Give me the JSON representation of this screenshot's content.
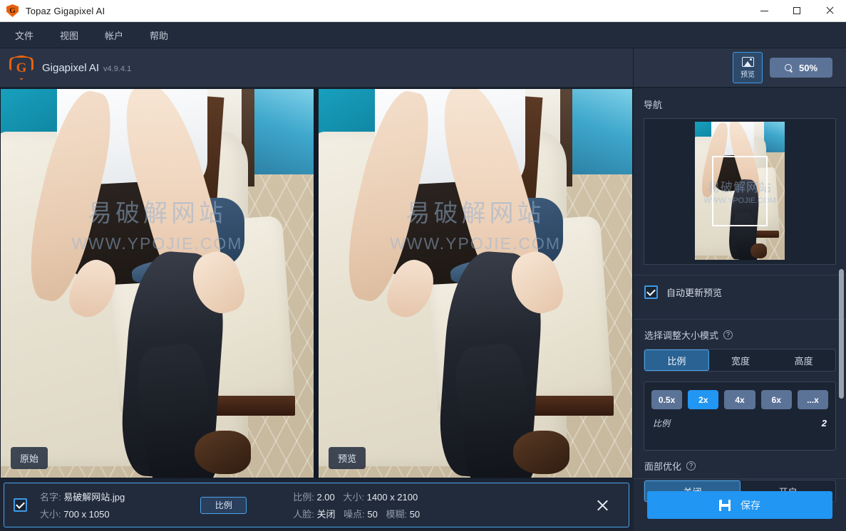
{
  "window": {
    "title": "Topaz Gigapixel AI",
    "logo_icon": "shield-g-icon",
    "minimize_icon": "minimize-icon",
    "maximize_icon": "maximize-icon",
    "close_icon": "close-icon"
  },
  "menubar": {
    "items": [
      {
        "label": "文件"
      },
      {
        "label": "视图"
      },
      {
        "label": "帐户"
      },
      {
        "label": "帮助"
      }
    ]
  },
  "header": {
    "brand_mark": "G",
    "brand_name": "Gigapixel AI",
    "version": "v4.9.4.1",
    "preview_button": {
      "label": "预览",
      "icon": "image-icon"
    },
    "zoom_button": {
      "label": "50%",
      "icon": "magnifier-icon"
    }
  },
  "compare": {
    "left": {
      "badge": "原始"
    },
    "right": {
      "badge": "预览"
    },
    "watermark_cn": "易破解网站",
    "watermark_en": "WWW.YPOJIE.COM"
  },
  "sidebar": {
    "navigator_title": "导航",
    "auto_update": {
      "label": "自动更新预览",
      "checked": true
    },
    "resize_mode": {
      "label": "选择调整大小模式",
      "help_icon": "question-mark-icon",
      "options": [
        "比例",
        "宽度",
        "高度"
      ],
      "selected": "比例"
    },
    "scale": {
      "options": [
        "0.5x",
        "2x",
        "4x",
        "6x",
        "...x"
      ],
      "selected": "2x",
      "meta_label": "比例",
      "meta_value": "2"
    },
    "face_refinement": {
      "label": "面部优化",
      "help_icon": "question-mark-icon",
      "options": [
        "关闭",
        "开启"
      ],
      "selected": "关闭"
    },
    "save_button": {
      "label": "保存",
      "icon": "floppy-disk-icon"
    }
  },
  "filebar": {
    "checked": true,
    "name_key": "名字:",
    "name_value": "易破解网站.jpg",
    "size_key": "大小:",
    "size_value": "700 x 1050",
    "ratio_button": "比例",
    "out_scale_key": "比例:",
    "out_scale_value": "2.00",
    "out_size_key": "大小:",
    "out_size_value": "1400 x 2100",
    "face_key": "人脸:",
    "face_value": "关闭",
    "noise_key": "噪点:",
    "noise_value": "50",
    "blur_key": "模糊:",
    "blur_value": "50",
    "close_icon": "close-icon"
  },
  "colors": {
    "accent": "#2196f3",
    "accent_border": "#4aa3ea",
    "panel": "#222b3b",
    "panel_dark": "#1b2433",
    "brand_orange": "#e8610f"
  }
}
